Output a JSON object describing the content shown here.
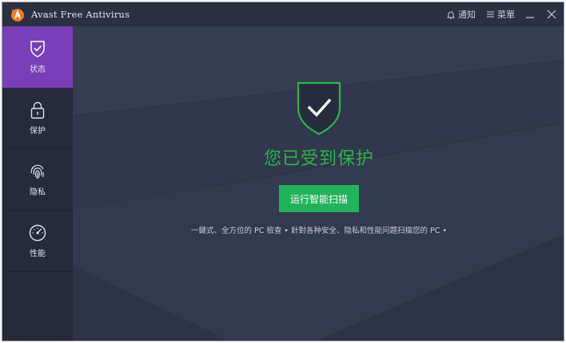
{
  "app": {
    "title": "Avast Free Antivirus"
  },
  "titlebar": {
    "notifications_label": "通知",
    "menu_label": "菜單"
  },
  "sidebar": {
    "items": [
      {
        "label": "状态",
        "icon": "shield-check-icon",
        "active": true
      },
      {
        "label": "保护",
        "icon": "lock-icon",
        "active": false
      },
      {
        "label": "隐私",
        "icon": "fingerprint-icon",
        "active": false
      },
      {
        "label": "性能",
        "icon": "speedometer-icon",
        "active": false
      }
    ]
  },
  "main": {
    "status_title": "您已受到保护",
    "scan_button_label": "运行智能扫描",
    "description": "一鍵式、全方位的 PC 檢查 • 針對各种安全、隐私和性能问题扫描您的 PC •"
  },
  "colors": {
    "accent_purple": "#7a3fb8",
    "status_green": "#2bb44a",
    "button_green": "#22b35a",
    "logo_orange": "#f47b20"
  }
}
